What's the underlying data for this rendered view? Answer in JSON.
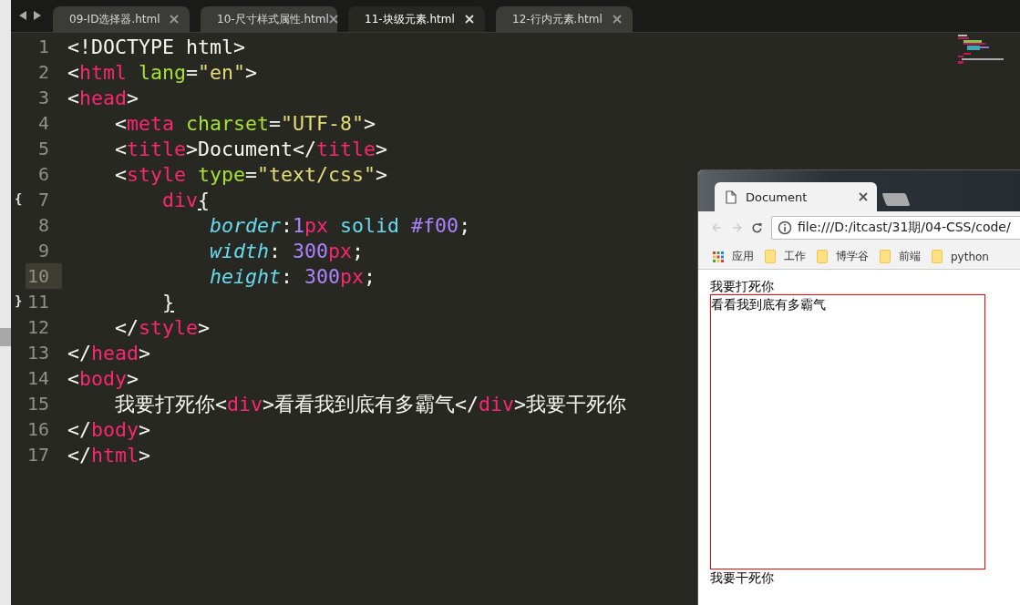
{
  "editor_tabs": [
    {
      "label": "09-ID选择器.html",
      "selected": false
    },
    {
      "label": "10-尺寸样式属性.html",
      "selected": false
    },
    {
      "label": "11-块级元素.html",
      "selected": true
    },
    {
      "label": "12-行内元素.html",
      "selected": false
    }
  ],
  "code_lines": [
    {
      "number": "1",
      "selected": false,
      "tokens": [
        {
          "kind": "plain",
          "text": "<!DOCTYPE html>"
        }
      ]
    },
    {
      "number": "2",
      "selected": false,
      "tokens": [
        {
          "kind": "plain",
          "text": "<"
        },
        {
          "kind": "tag",
          "text": "html"
        },
        {
          "kind": "attr",
          "text": " lang"
        },
        {
          "kind": "plain",
          "text": "="
        },
        {
          "kind": "str",
          "text": "\"en\""
        },
        {
          "kind": "plain",
          "text": ">"
        }
      ]
    },
    {
      "number": "3",
      "selected": false,
      "tokens": [
        {
          "kind": "plain",
          "text": "<"
        },
        {
          "kind": "tag",
          "text": "head"
        },
        {
          "kind": "plain",
          "text": ">"
        }
      ]
    },
    {
      "number": "4",
      "selected": false,
      "tokens": [
        {
          "kind": "plain",
          "text": "    <"
        },
        {
          "kind": "tag",
          "text": "meta"
        },
        {
          "kind": "attr",
          "text": " charset"
        },
        {
          "kind": "plain",
          "text": "="
        },
        {
          "kind": "str",
          "text": "\"UTF-8\""
        },
        {
          "kind": "plain",
          "text": ">"
        }
      ]
    },
    {
      "number": "5",
      "selected": false,
      "tokens": [
        {
          "kind": "plain",
          "text": "    <"
        },
        {
          "kind": "tag",
          "text": "title"
        },
        {
          "kind": "plain",
          "text": ">Document</"
        },
        {
          "kind": "tag",
          "text": "title"
        },
        {
          "kind": "plain",
          "text": ">"
        }
      ]
    },
    {
      "number": "6",
      "selected": false,
      "tokens": [
        {
          "kind": "plain",
          "text": "    <"
        },
        {
          "kind": "tag",
          "text": "style"
        },
        {
          "kind": "attr",
          "text": " type"
        },
        {
          "kind": "plain",
          "text": "="
        },
        {
          "kind": "str",
          "text": "\"text/css\""
        },
        {
          "kind": "plain",
          "text": ">"
        }
      ]
    },
    {
      "number": "7",
      "fold": "{",
      "selected": false,
      "tokens": [
        {
          "kind": "tag",
          "text": "        div"
        },
        {
          "kind": "match",
          "text": "{"
        }
      ]
    },
    {
      "number": "8",
      "selected": false,
      "tokens": [
        {
          "kind": "prop",
          "text": "            border"
        },
        {
          "kind": "plain",
          "text": ":"
        },
        {
          "kind": "num",
          "text": "1"
        },
        {
          "kind": "tag",
          "text": "px"
        },
        {
          "kind": "value",
          "text": " solid "
        },
        {
          "kind": "num",
          "text": "#f00"
        },
        {
          "kind": "plain",
          "text": ";"
        }
      ]
    },
    {
      "number": "9",
      "selected": false,
      "tokens": [
        {
          "kind": "prop",
          "text": "            width"
        },
        {
          "kind": "plain",
          "text": ": "
        },
        {
          "kind": "num",
          "text": "300"
        },
        {
          "kind": "tag",
          "text": "px"
        },
        {
          "kind": "plain",
          "text": ";"
        }
      ]
    },
    {
      "number": "10",
      "selected": true,
      "tokens": [
        {
          "kind": "prop",
          "text": "            height"
        },
        {
          "kind": "plain",
          "text": ": "
        },
        {
          "kind": "num",
          "text": "300"
        },
        {
          "kind": "tag",
          "text": "px"
        },
        {
          "kind": "plain",
          "text": ";"
        }
      ]
    },
    {
      "number": "11",
      "fold": "}",
      "selected": false,
      "tokens": [
        {
          "kind": "match",
          "text": "        }"
        }
      ]
    },
    {
      "number": "12",
      "selected": false,
      "tokens": [
        {
          "kind": "plain",
          "text": "    </"
        },
        {
          "kind": "tag",
          "text": "style"
        },
        {
          "kind": "plain",
          "text": ">"
        }
      ]
    },
    {
      "number": "13",
      "selected": false,
      "tokens": [
        {
          "kind": "plain",
          "text": "</"
        },
        {
          "kind": "tag",
          "text": "head"
        },
        {
          "kind": "plain",
          "text": ">"
        }
      ]
    },
    {
      "number": "14",
      "selected": false,
      "tokens": [
        {
          "kind": "plain",
          "text": "<"
        },
        {
          "kind": "tag",
          "text": "body"
        },
        {
          "kind": "plain",
          "text": ">"
        }
      ]
    },
    {
      "number": "15",
      "selected": false,
      "tokens": [
        {
          "kind": "plain",
          "text": "    我要打死你<"
        },
        {
          "kind": "tag",
          "text": "div"
        },
        {
          "kind": "plain",
          "text": ">看看我到底有多霸气</"
        },
        {
          "kind": "tag",
          "text": "div"
        },
        {
          "kind": "plain",
          "text": ">我要干死你"
        }
      ]
    },
    {
      "number": "16",
      "selected": false,
      "tokens": [
        {
          "kind": "plain",
          "text": "</"
        },
        {
          "kind": "tag",
          "text": "body"
        },
        {
          "kind": "plain",
          "text": ">"
        }
      ]
    },
    {
      "number": "17",
      "selected": false,
      "tokens": [
        {
          "kind": "plain",
          "text": "</"
        },
        {
          "kind": "tag",
          "text": "html"
        },
        {
          "kind": "plain",
          "text": ">"
        }
      ]
    }
  ],
  "browser": {
    "tabs": [
      {
        "label": "Document",
        "selected": true
      }
    ],
    "address": "file:///D:/itcast/31期/04-CSS/code/",
    "bookmarks": [
      {
        "kind": "apps",
        "label": "应用"
      },
      {
        "kind": "folder",
        "label": "工作"
      },
      {
        "kind": "folder",
        "label": "博学谷"
      },
      {
        "kind": "folder",
        "label": "前端"
      },
      {
        "kind": "folder",
        "label": "python"
      }
    ],
    "page": {
      "before_text": "我要打死你",
      "box_text": "看看我到底有多霸气",
      "after_text": "我要干死你"
    }
  }
}
